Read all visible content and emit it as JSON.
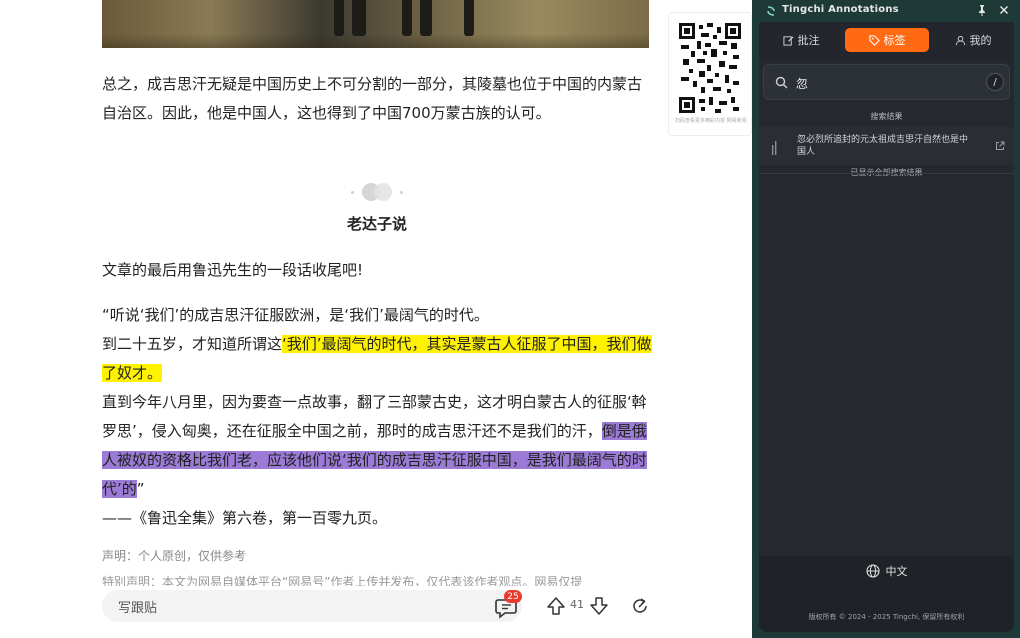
{
  "article": {
    "para1": "总之，成吉思汗无疑是中国历史上不可分割的一部分，其陵墓也位于中国的内蒙古自治区。因此，他是中国人，这也得到了中国700万蒙古族的认可。",
    "heading": "老达子说",
    "para2": "文章的最后用鲁迅先生的一段话收尾吧!",
    "quote_line1": "“听说‘我们’的成吉思汗征服欧洲，是‘我们’最阔气的时代。",
    "quote_line2_plain": "到二十五岁，才知道所谓这",
    "quote_line2_yellow": "‘我们’最阔气的时代，其实是蒙古人征服了中国，我们做了奴才。",
    "quote_line3_plain": "直到今年八月里，因为要查一点故事，翻了三部蒙古史，这才明白蒙古人的征服‘斡罗思’，侵入匈奥，还在征服全中国之前，那时的成吉思汗还不是我们的汗，",
    "quote_line3_purple": "倒是俄人被奴的资格比我们老，应该他们说‘我们的成吉思汗征服中国，是我们最阔气的时代’的",
    "quote_line3_end": "”",
    "source": "——《鲁迅全集》第六卷，第一百零九页。",
    "declaration": "声明：个人原创，仅供参考",
    "special_notice": "特别声明：本文为网易自媒体平台“网易号”作者上传并发布，仅代表该作者观点。网易仅提",
    "qr_caption": "扫码查看更多精彩内容 网易新闻APP"
  },
  "bottombar": {
    "reply_placeholder": "写跟贴",
    "comment_count": "25",
    "vote_count": "41"
  },
  "panel": {
    "title": "Tingchi Annotations",
    "tabs": [
      {
        "label": "批注",
        "active": false
      },
      {
        "label": "标签",
        "active": true
      },
      {
        "label": "我的",
        "active": false
      }
    ],
    "search_value": "忽",
    "shortcut": "/",
    "results_title": "搜索结果",
    "results": [
      {
        "text": "忽必烈所追封的元太祖成吉思汗自然也是中国人"
      }
    ],
    "results_end": "已显示全部搜索结果",
    "language": "中文",
    "copyright": "版权所有 © 2024 - 2025 Tingchi, 保留所有权利"
  },
  "colors": {
    "accent_orange": "#ff6a13",
    "highlight_yellow": "#fff200",
    "highlight_purple": "#9b7bd6",
    "panel_bg": "#25292f",
    "panel_frame": "#1e3a36"
  }
}
